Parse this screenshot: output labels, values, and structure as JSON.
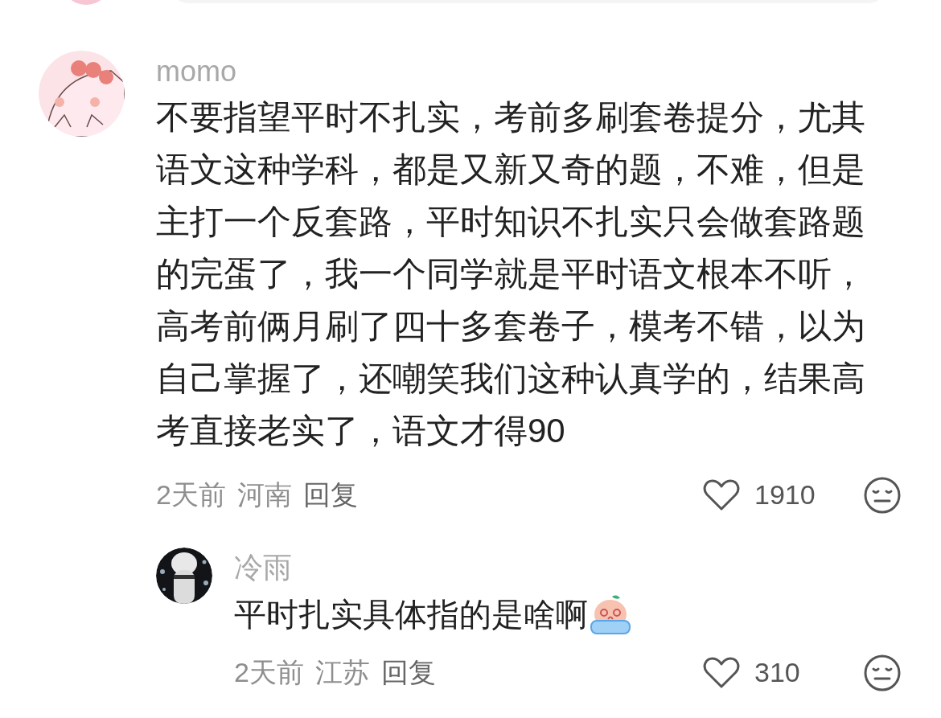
{
  "comments": [
    {
      "kind": "comment",
      "author": "momo",
      "text": "不要指望平时不扎实，考前多刷套卷提分，尤其语文这种学科，都是又新又奇的题，不难，但是主打一个反套路，平时知识不扎实只会做套路题的完蛋了，我一个同学就是平时语文根本不听，高考前俩月刷了四十多套卷子，模考不错，以为自己掌握了，还嘲笑我们这种认真学的，结果高考直接老实了，语文才得90",
      "time": "2天前",
      "location": "河南",
      "reply_label": "回复",
      "likes": "1910",
      "liked": false,
      "children": [
        {
          "kind": "reply",
          "author": "冷雨",
          "text": "平时扎实具体指的是啥啊",
          "emoji": true,
          "time": "2天前",
          "location": "江苏",
          "reply_label": "回复",
          "likes": "310",
          "liked": false
        }
      ]
    }
  ]
}
